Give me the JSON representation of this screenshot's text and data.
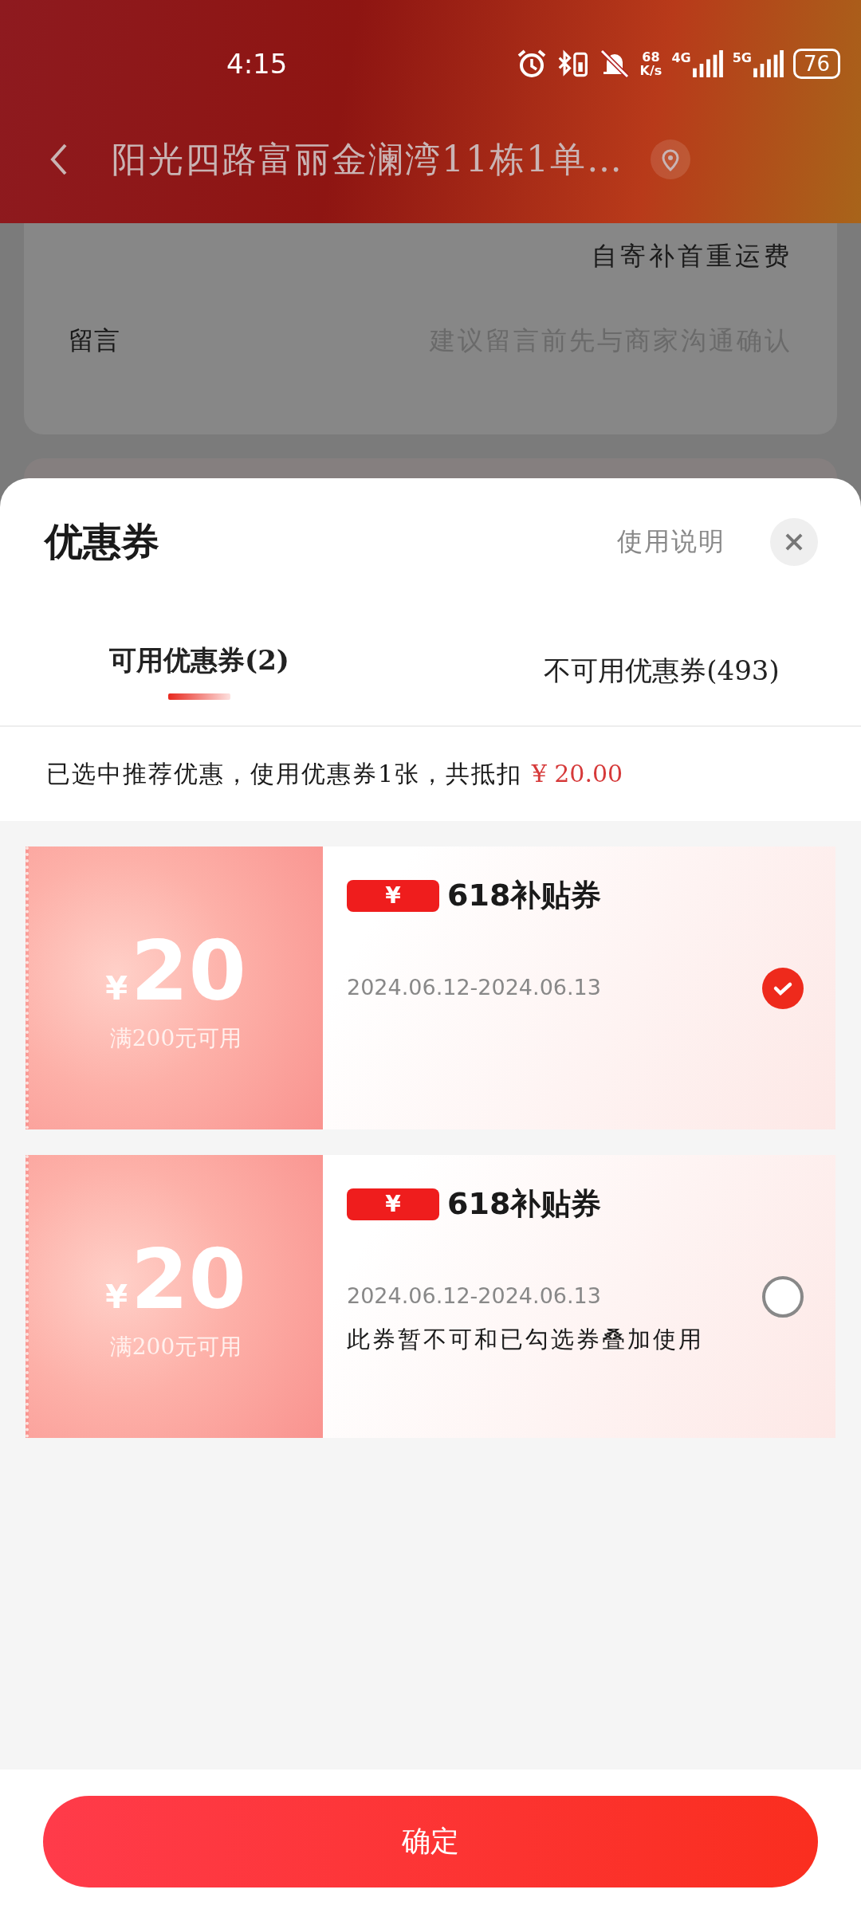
{
  "status_bar": {
    "time": "4:15",
    "speed_value": "68",
    "speed_unit": "K/s",
    "signals": [
      {
        "label": "4G"
      },
      {
        "label": "5G"
      }
    ],
    "battery": "76"
  },
  "header": {
    "title": "阳光四路富丽金澜湾11栋1单…"
  },
  "background": {
    "shipping_note": "自寄补首重运费",
    "message_label": "留言",
    "message_placeholder": "建议留言前先与商家沟通确认"
  },
  "sheet": {
    "title": "优惠券",
    "help_link": "使用说明",
    "tabs": [
      {
        "label": "可用优惠券(2)",
        "selected": true
      },
      {
        "label": "不可用优惠券(493)",
        "selected": false
      }
    ],
    "summary": {
      "text": "已选中推荐优惠，使用优惠券1张，共抵扣",
      "amount": "¥ 20.00"
    },
    "coupons": [
      {
        "currency": "¥",
        "amount": "20",
        "condition": "满200元可用",
        "badge": "¥",
        "name": "618补贴券",
        "validity": "2024.06.12-2024.06.13",
        "selected": true
      },
      {
        "currency": "¥",
        "amount": "20",
        "condition": "满200元可用",
        "badge": "¥",
        "name": "618补贴券",
        "validity": "2024.06.12-2024.06.13",
        "note": "此券暂不可和已勾选券叠加使用",
        "selected": false
      }
    ],
    "confirm_button": "确定"
  }
}
